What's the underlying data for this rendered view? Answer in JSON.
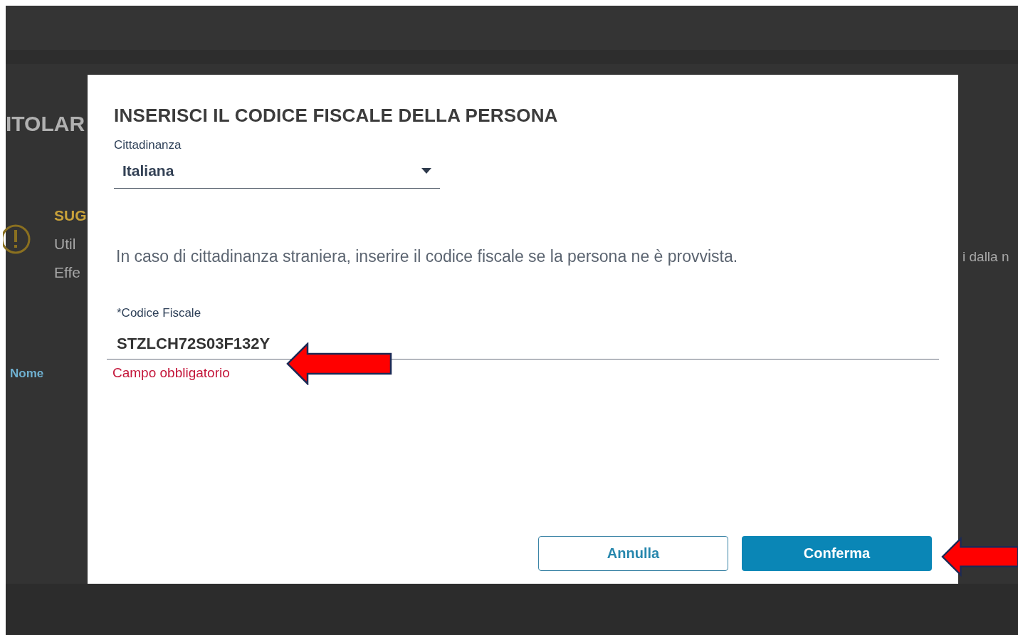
{
  "background": {
    "page_title": "ITOLAR",
    "notice": {
      "title": "SUG",
      "lines": [
        "Util",
        "Effe"
      ],
      "line_right": "i dalla n"
    },
    "column_header": "Nome"
  },
  "dialog": {
    "title": "INSERISCI IL CODICE FISCALE DELLA PERSONA",
    "citizenship": {
      "label": "Cittadinanza",
      "value": "Italiana"
    },
    "hint": "In caso di cittadinanza straniera, inserire il codice fiscale se la persona ne è provvista.",
    "tax_code": {
      "label": "*Codice Fiscale",
      "value": "STZLCH72S03F132Y",
      "error": "Campo obbligatorio"
    },
    "buttons": [
      {
        "label": "Annulla",
        "kind": "secondary"
      },
      {
        "label": "Conferma",
        "kind": "primary"
      }
    ]
  }
}
